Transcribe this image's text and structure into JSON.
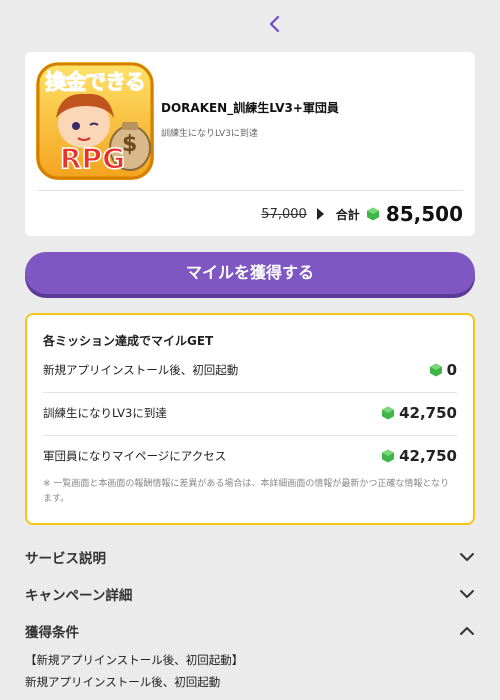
{
  "header": {
    "back_icon": "chevron-left-icon",
    "accent": "#6a4fc4"
  },
  "app": {
    "name": "DORAKEN_訓練生LV3+軍団員",
    "subtitle": "訓練生になりLV3に到達",
    "icon_text_top": "換金できる",
    "icon_text_bottom": "RPG",
    "icon_dollar": "$",
    "old_price": "57,000",
    "total_label": "合計",
    "total_value": "85,500"
  },
  "cta": {
    "label": "マイルを獲得する",
    "color": "#7e57c2"
  },
  "missions": {
    "title": "各ミッション達成でマイルGET",
    "items": [
      {
        "label": "新規アプリインストール後、初回起動",
        "value": "0"
      },
      {
        "label": "訓練生になりLV3に到達",
        "value": "42,750"
      },
      {
        "label": "軍団員になりマイページにアクセス",
        "value": "42,750"
      }
    ],
    "note": "※ 一覧画面と本画面の報酬情報に差異がある場合は、本詳細画面の情報が最新かつ正確な情報となります。",
    "border_color": "#f5c518"
  },
  "accordions": [
    {
      "label": "サービス説明",
      "state": "collapsed"
    },
    {
      "label": "キャンペーン詳細",
      "state": "collapsed"
    },
    {
      "label": "獲得条件",
      "state": "expanded"
    }
  ],
  "conditions": {
    "heading": "【新規アプリインストール後、初回起動】",
    "text": "新規アプリインストール後、初回起動"
  }
}
